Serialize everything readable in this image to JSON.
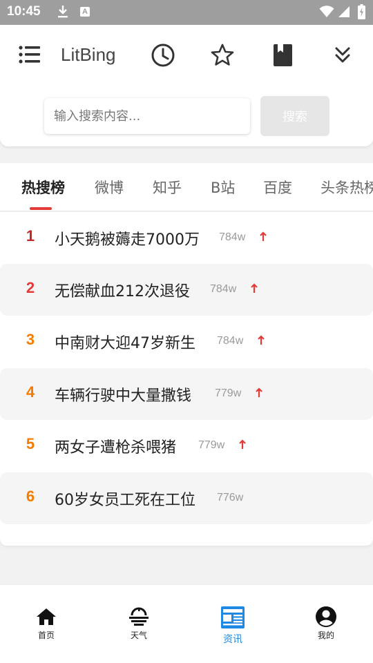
{
  "status_bar": {
    "time": "10:45",
    "notif_letter": "A"
  },
  "header": {
    "title": "LitBing",
    "search_placeholder": "输入搜索内容...",
    "search_button": "搜索"
  },
  "tabs": [
    {
      "label": "热搜榜",
      "active": true
    },
    {
      "label": "微博"
    },
    {
      "label": "知乎"
    },
    {
      "label": "B站"
    },
    {
      "label": "百度"
    },
    {
      "label": "头条热榜"
    }
  ],
  "colors": {
    "rank_top": "#c62828",
    "rank_red": "#e53935",
    "rank_orange": "#f57c00",
    "accent_blue": "#1e88e5",
    "arrow": "#e53935"
  },
  "hot_list": [
    {
      "rank": "1",
      "title": "小天鹅被薅走7000万",
      "heat": "784w",
      "trend": "up"
    },
    {
      "rank": "2",
      "title": "无偿献血212次退役",
      "heat": "784w",
      "trend": "up"
    },
    {
      "rank": "3",
      "title": "中南财大迎47岁新生",
      "heat": "784w",
      "trend": "up"
    },
    {
      "rank": "4",
      "title": "车辆行驶中大量撒钱",
      "heat": "779w",
      "trend": "up"
    },
    {
      "rank": "5",
      "title": "两女子遭枪杀喂猪",
      "heat": "779w",
      "trend": "up"
    },
    {
      "rank": "6",
      "title": "60岁女员工死在工位",
      "heat": "776w",
      "trend": ""
    }
  ],
  "bottom_nav": [
    {
      "label": "首页",
      "icon": "home-icon"
    },
    {
      "label": "天气",
      "icon": "weather-icon"
    },
    {
      "label": "资讯",
      "icon": "news-icon",
      "active": true
    },
    {
      "label": "我的",
      "icon": "profile-icon"
    }
  ]
}
